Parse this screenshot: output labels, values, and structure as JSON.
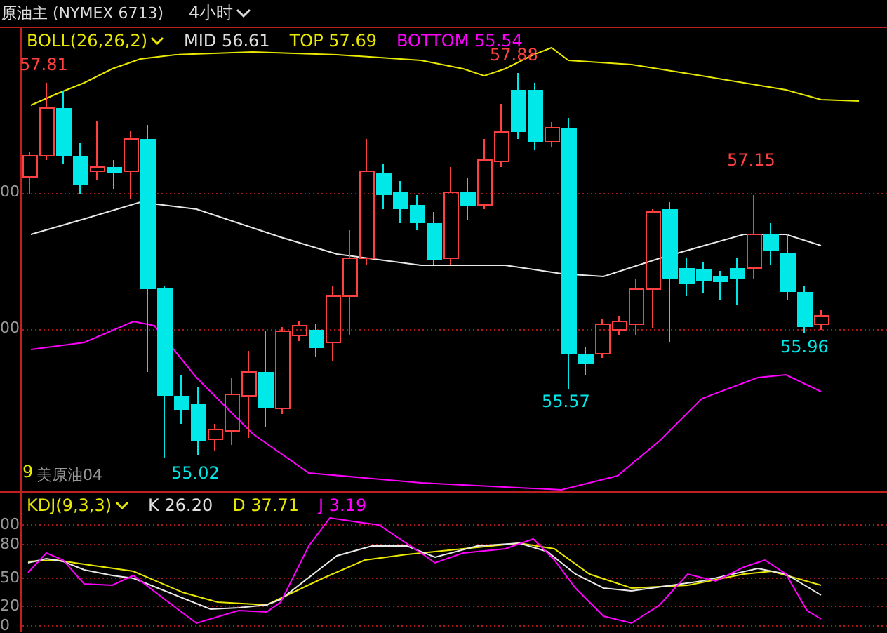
{
  "top_bar": {
    "instrument": "原油主 (NYMEX 6713)",
    "period": "4小时"
  },
  "boll_legend": [
    {
      "kind": "name",
      "text": "BOLL(26,26,2)"
    },
    {
      "kind": "mid",
      "text": "MID 56.61"
    },
    {
      "kind": "top",
      "text": "TOP 57.69"
    },
    {
      "kind": "bottom",
      "text": "BOTTOM 55.54"
    }
  ],
  "price_axis": [
    "00",
    "00"
  ],
  "price_labels": [
    {
      "kind": "high",
      "text": "57.81"
    },
    {
      "kind": "high",
      "text": "57.88"
    },
    {
      "kind": "high",
      "text": "57.15"
    },
    {
      "kind": "low",
      "text": "55.02"
    },
    {
      "kind": "low",
      "text": "55.57"
    },
    {
      "kind": "low",
      "text": "55.96"
    }
  ],
  "contract_label": {
    "code": "9",
    "name": "美原油04"
  },
  "kdj_legend": [
    {
      "kind": "name",
      "text": "KDJ(9,3,3)"
    },
    {
      "kind": "k",
      "text": "K 26.20"
    },
    {
      "kind": "d",
      "text": "D 37.71"
    },
    {
      "kind": "j",
      "text": "J 3.19"
    }
  ],
  "kdj_axis": [
    "00",
    "80",
    "50",
    "20",
    "0"
  ]
}
